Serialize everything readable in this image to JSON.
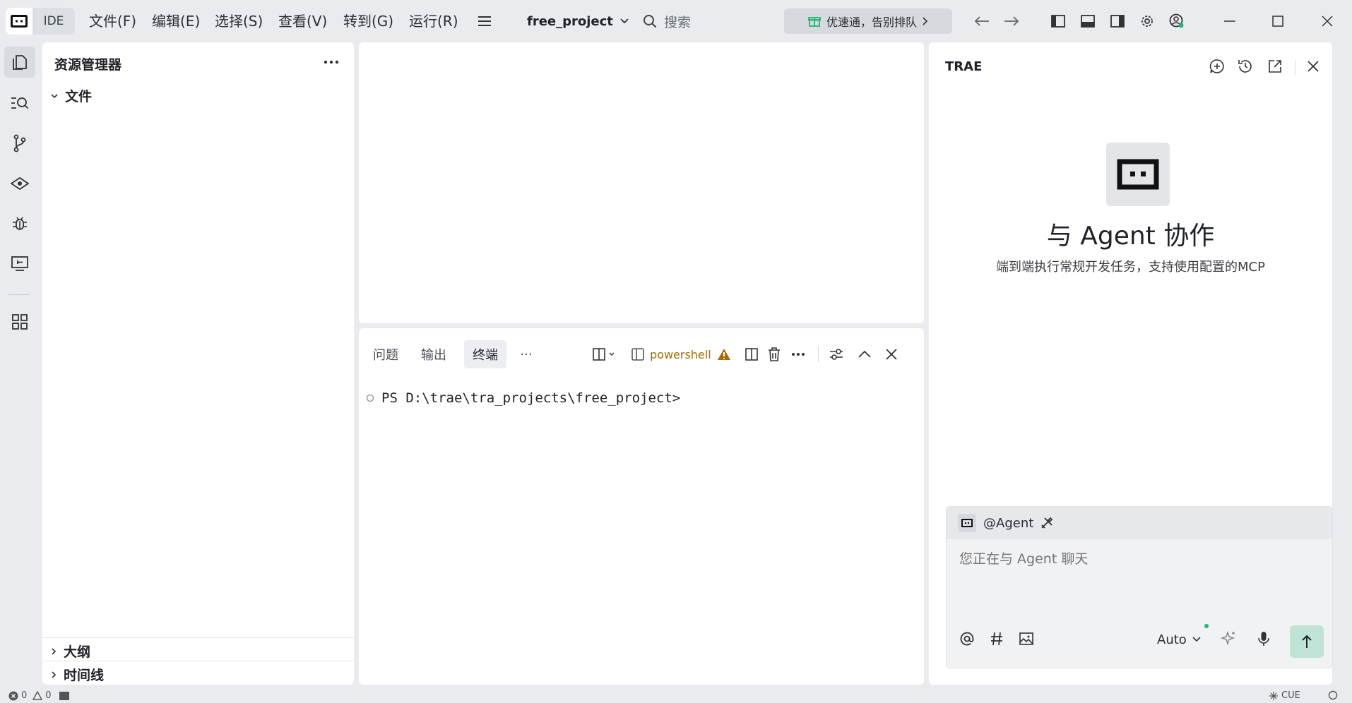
{
  "titlebar": {
    "app_label": "IDE",
    "menu": [
      "文件(F)",
      "编辑(E)",
      "选择(S)",
      "查看(V)",
      "转到(G)",
      "运行(R)"
    ],
    "project": "free_project",
    "search_placeholder": "搜索",
    "promo": "优速通，告别排队"
  },
  "sidebar": {
    "title": "资源管理器",
    "tree_files": "文件",
    "outline": "大纲",
    "timeline": "时间线"
  },
  "bottom_panel": {
    "tabs": [
      "问题",
      "输出",
      "终端"
    ],
    "more": "···",
    "shell": "powershell",
    "prompt": "PS D:\\trae\\tra_projects\\free_project>"
  },
  "right_panel": {
    "title": "TRAE",
    "heading": "与 Agent 协作",
    "subtitle": "端到端执行常规开发任务，支持使用配置的MCP",
    "agent_tag": "@Agent",
    "chat_placeholder": "您正在与 Agent 聊天",
    "model": "Auto"
  },
  "statusbar": {
    "errors": "0",
    "warnings": "0",
    "right_text": "CUE"
  },
  "colors": {
    "background": "#e9ebef",
    "panel": "#ffffff",
    "accent_green": "#22b573",
    "warning": "#a36b00",
    "send_button": "#bfe3d4"
  }
}
